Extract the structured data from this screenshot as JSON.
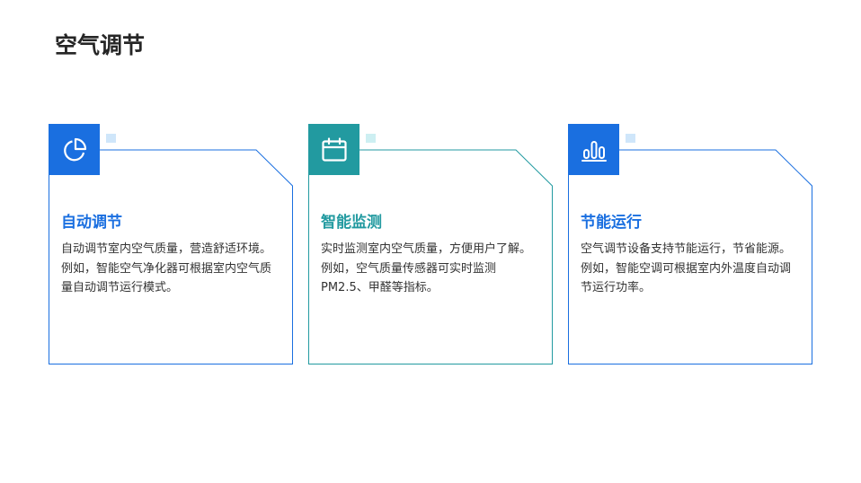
{
  "page": {
    "title": "空气调节"
  },
  "cards": [
    {
      "icon": "pie-chart-icon",
      "accent_color": "#1a6fe0",
      "title": "自动调节",
      "lines": [
        "自动调节室内空气质量，营造舒适环境。",
        "例如，智能空气净化器可根据室内空气质量自动调节运行模式。"
      ]
    },
    {
      "icon": "calendar-icon",
      "accent_color": "#229aa0",
      "title": "智能监测",
      "lines": [
        "实时监测室内空气质量，方便用户了解。",
        "例如，空气质量传感器可实时监测PM2.5、甲醛等指标。"
      ]
    },
    {
      "icon": "bar-chart-icon",
      "accent_color": "#1a6fe0",
      "title": "节能运行",
      "lines": [
        "空气调节设备支持节能运行，节省能源。",
        "例如，智能空调可根据室内外温度自动调节运行功率。"
      ]
    }
  ]
}
